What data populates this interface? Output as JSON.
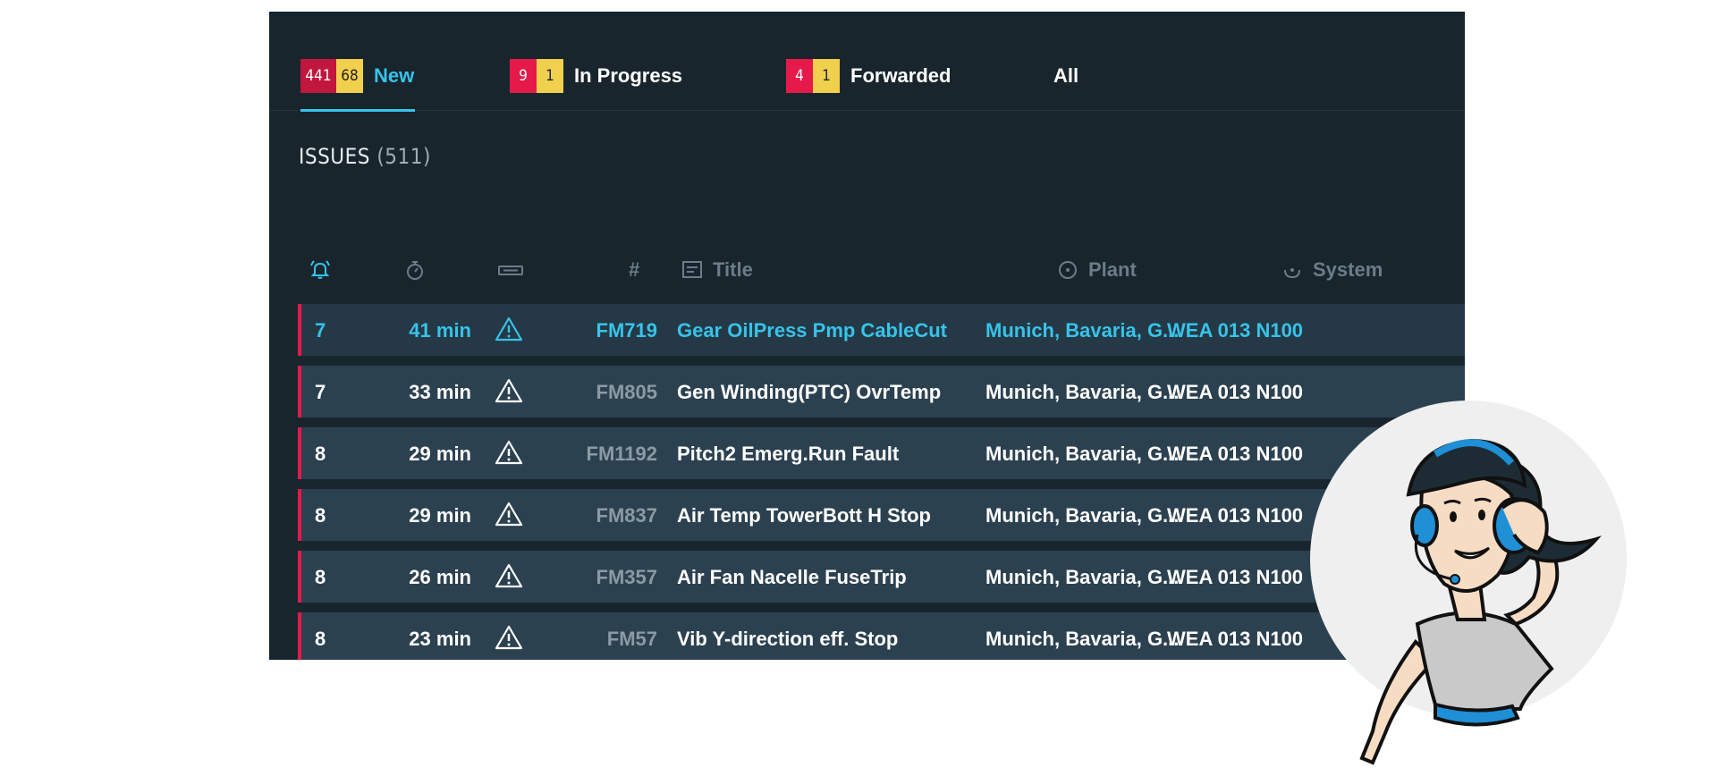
{
  "tabs": [
    {
      "badges": [
        "441",
        "68"
      ],
      "label": "New"
    },
    {
      "badges": [
        "9",
        "1"
      ],
      "label": "In Progress"
    },
    {
      "badges": [
        "4",
        "1"
      ],
      "label": "Forwarded"
    },
    {
      "badges": [],
      "label": "All"
    }
  ],
  "issues": {
    "title": "ISSUES",
    "count": "(511)"
  },
  "columns": {
    "id": "#",
    "title": "Title",
    "plant": "Plant",
    "system": "System"
  },
  "rows": [
    {
      "prio": "7",
      "time": "41 min",
      "id": "FM719",
      "title": "Gear OilPress Pmp CableCut",
      "plant": "Munich, Bavaria, G...",
      "system": "WEA 013 N100"
    },
    {
      "prio": "7",
      "time": "33 min",
      "id": "FM805",
      "title": "Gen Winding(PTC) OvrTemp",
      "plant": "Munich, Bavaria, G...",
      "system": "WEA 013 N100"
    },
    {
      "prio": "8",
      "time": "29 min",
      "id": "FM1192",
      "title": "Pitch2 Emerg.Run Fault",
      "plant": "Munich, Bavaria, G...",
      "system": "WEA 013 N100"
    },
    {
      "prio": "8",
      "time": "29 min",
      "id": "FM837",
      "title": "Air Temp TowerBott H Stop",
      "plant": "Munich, Bavaria, G...",
      "system": "WEA 013 N100"
    },
    {
      "prio": "8",
      "time": "26 min",
      "id": "FM357",
      "title": "Air Fan Nacelle FuseTrip",
      "plant": "Munich, Bavaria, G...",
      "system": "WEA 013 N100"
    },
    {
      "prio": "8",
      "time": "23 min",
      "id": "FM57",
      "title": "Vib Y-direction eff. Stop",
      "plant": "Munich, Bavaria, G...",
      "system": "WEA 013 N100"
    }
  ],
  "colors": {
    "accent": "#37c3ea",
    "alert": "#e5194a",
    "warning": "#f1d04d",
    "panel": "#19252d",
    "row": "#2c4150"
  }
}
